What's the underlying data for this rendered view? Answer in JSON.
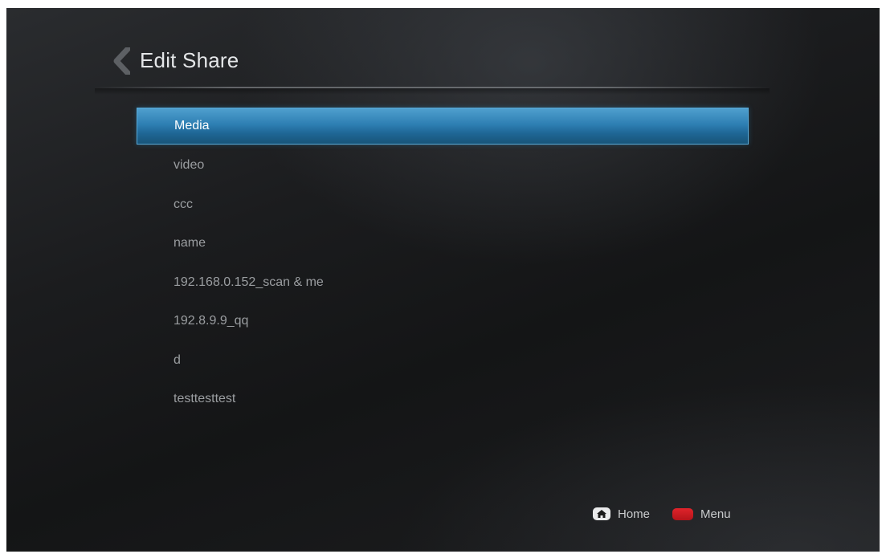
{
  "header": {
    "title": "Edit Share",
    "back_icon": "chevron-left-icon"
  },
  "share_list": {
    "selected_index": 0,
    "items": [
      {
        "label": "Media"
      },
      {
        "label": "video"
      },
      {
        "label": "ccc"
      },
      {
        "label": "name"
      },
      {
        "label": "192.168.0.152_scan & me"
      },
      {
        "label": "192.8.9.9_qq"
      },
      {
        "label": "d"
      },
      {
        "label": "testtesttest"
      }
    ]
  },
  "footer": {
    "home": {
      "label": "Home",
      "icon": "home-icon"
    },
    "menu": {
      "label": "Menu",
      "icon": "red-key-icon"
    }
  },
  "colors": {
    "selection": "#2e7fb3",
    "red_key": "#cc1c22",
    "text_dim": "#9b9ea1",
    "text_bright": "#ffffff"
  }
}
